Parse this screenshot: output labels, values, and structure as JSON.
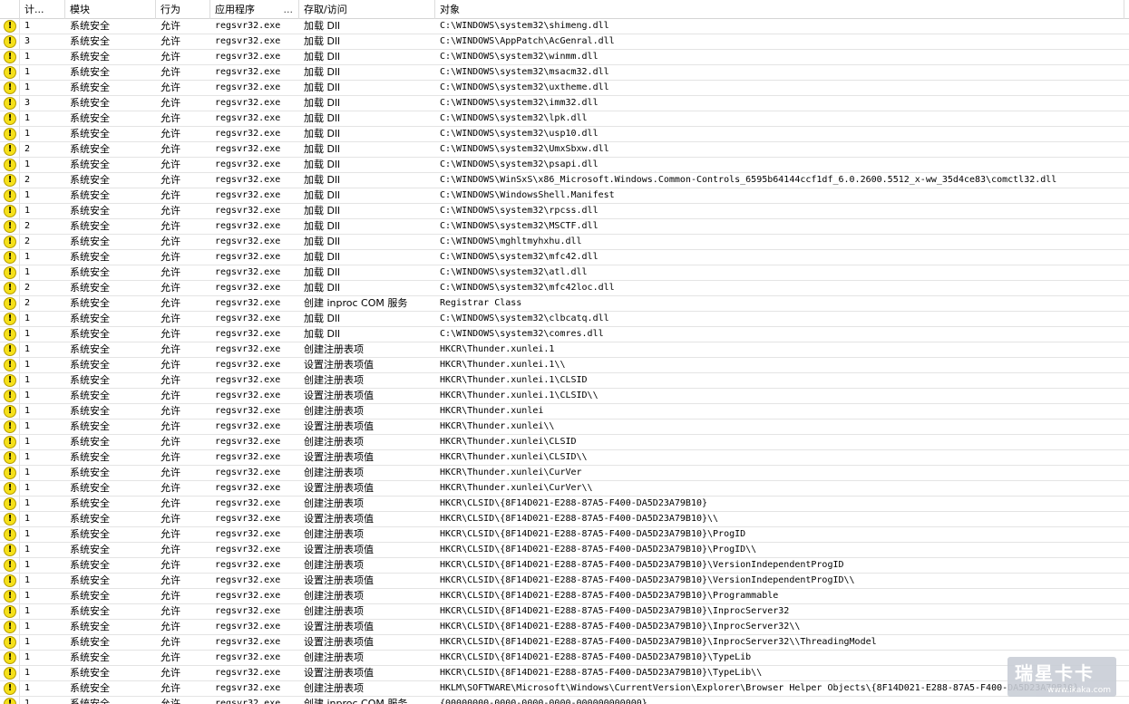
{
  "columns": {
    "count": "计...",
    "module": "模块",
    "action": "行为",
    "app": "应用程序",
    "app_more": "...",
    "access": "存取/访问",
    "object": "对象"
  },
  "colors": {
    "warning_icon": "#f6e11a"
  },
  "rows": [
    {
      "count": "1",
      "module": "系统安全",
      "action": "允许",
      "app": "regsvr32.exe",
      "access": "加载 Dll",
      "object": "C:\\WINDOWS\\system32\\shimeng.dll"
    },
    {
      "count": "3",
      "module": "系统安全",
      "action": "允许",
      "app": "regsvr32.exe",
      "access": "加载 Dll",
      "object": "C:\\WINDOWS\\AppPatch\\AcGenral.dll"
    },
    {
      "count": "1",
      "module": "系统安全",
      "action": "允许",
      "app": "regsvr32.exe",
      "access": "加载 Dll",
      "object": "C:\\WINDOWS\\system32\\winmm.dll"
    },
    {
      "count": "1",
      "module": "系统安全",
      "action": "允许",
      "app": "regsvr32.exe",
      "access": "加载 Dll",
      "object": "C:\\WINDOWS\\system32\\msacm32.dll"
    },
    {
      "count": "1",
      "module": "系统安全",
      "action": "允许",
      "app": "regsvr32.exe",
      "access": "加载 Dll",
      "object": "C:\\WINDOWS\\system32\\uxtheme.dll"
    },
    {
      "count": "3",
      "module": "系统安全",
      "action": "允许",
      "app": "regsvr32.exe",
      "access": "加载 Dll",
      "object": "C:\\WINDOWS\\system32\\imm32.dll"
    },
    {
      "count": "1",
      "module": "系统安全",
      "action": "允许",
      "app": "regsvr32.exe",
      "access": "加载 Dll",
      "object": "C:\\WINDOWS\\system32\\lpk.dll"
    },
    {
      "count": "1",
      "module": "系统安全",
      "action": "允许",
      "app": "regsvr32.exe",
      "access": "加载 Dll",
      "object": "C:\\WINDOWS\\system32\\usp10.dll"
    },
    {
      "count": "2",
      "module": "系统安全",
      "action": "允许",
      "app": "regsvr32.exe",
      "access": "加载 Dll",
      "object": "C:\\WINDOWS\\system32\\UmxSbxw.dll"
    },
    {
      "count": "1",
      "module": "系统安全",
      "action": "允许",
      "app": "regsvr32.exe",
      "access": "加载 Dll",
      "object": "C:\\WINDOWS\\system32\\psapi.dll"
    },
    {
      "count": "2",
      "module": "系统安全",
      "action": "允许",
      "app": "regsvr32.exe",
      "access": "加载 Dll",
      "object": "C:\\WINDOWS\\WinSxS\\x86_Microsoft.Windows.Common-Controls_6595b64144ccf1df_6.0.2600.5512_x-ww_35d4ce83\\comctl32.dll"
    },
    {
      "count": "1",
      "module": "系统安全",
      "action": "允许",
      "app": "regsvr32.exe",
      "access": "加载 Dll",
      "object": "C:\\WINDOWS\\WindowsShell.Manifest"
    },
    {
      "count": "1",
      "module": "系统安全",
      "action": "允许",
      "app": "regsvr32.exe",
      "access": "加载 Dll",
      "object": "C:\\WINDOWS\\system32\\rpcss.dll"
    },
    {
      "count": "2",
      "module": "系统安全",
      "action": "允许",
      "app": "regsvr32.exe",
      "access": "加载 Dll",
      "object": "C:\\WINDOWS\\system32\\MSCTF.dll"
    },
    {
      "count": "2",
      "module": "系统安全",
      "action": "允许",
      "app": "regsvr32.exe",
      "access": "加载 Dll",
      "object": "C:\\WINDOWS\\mghltmyhxhu.dll"
    },
    {
      "count": "1",
      "module": "系统安全",
      "action": "允许",
      "app": "regsvr32.exe",
      "access": "加载 Dll",
      "object": "C:\\WINDOWS\\system32\\mfc42.dll"
    },
    {
      "count": "1",
      "module": "系统安全",
      "action": "允许",
      "app": "regsvr32.exe",
      "access": "加载 Dll",
      "object": "C:\\WINDOWS\\system32\\atl.dll"
    },
    {
      "count": "2",
      "module": "系统安全",
      "action": "允许",
      "app": "regsvr32.exe",
      "access": "加载 Dll",
      "object": "C:\\WINDOWS\\system32\\mfc42loc.dll"
    },
    {
      "count": "2",
      "module": "系统安全",
      "action": "允许",
      "app": "regsvr32.exe",
      "access": "创建 inproc COM 服务",
      "object": "Registrar Class"
    },
    {
      "count": "1",
      "module": "系统安全",
      "action": "允许",
      "app": "regsvr32.exe",
      "access": "加载 Dll",
      "object": "C:\\WINDOWS\\system32\\clbcatq.dll"
    },
    {
      "count": "1",
      "module": "系统安全",
      "action": "允许",
      "app": "regsvr32.exe",
      "access": "加载 Dll",
      "object": "C:\\WINDOWS\\system32\\comres.dll"
    },
    {
      "count": "1",
      "module": "系统安全",
      "action": "允许",
      "app": "regsvr32.exe",
      "access": "创建注册表项",
      "object": "HKCR\\Thunder.xunlei.1"
    },
    {
      "count": "1",
      "module": "系统安全",
      "action": "允许",
      "app": "regsvr32.exe",
      "access": "设置注册表项值",
      "object": "HKCR\\Thunder.xunlei.1\\\\"
    },
    {
      "count": "1",
      "module": "系统安全",
      "action": "允许",
      "app": "regsvr32.exe",
      "access": "创建注册表项",
      "object": "HKCR\\Thunder.xunlei.1\\CLSID"
    },
    {
      "count": "1",
      "module": "系统安全",
      "action": "允许",
      "app": "regsvr32.exe",
      "access": "设置注册表项值",
      "object": "HKCR\\Thunder.xunlei.1\\CLSID\\\\"
    },
    {
      "count": "1",
      "module": "系统安全",
      "action": "允许",
      "app": "regsvr32.exe",
      "access": "创建注册表项",
      "object": "HKCR\\Thunder.xunlei"
    },
    {
      "count": "1",
      "module": "系统安全",
      "action": "允许",
      "app": "regsvr32.exe",
      "access": "设置注册表项值",
      "object": "HKCR\\Thunder.xunlei\\\\"
    },
    {
      "count": "1",
      "module": "系统安全",
      "action": "允许",
      "app": "regsvr32.exe",
      "access": "创建注册表项",
      "object": "HKCR\\Thunder.xunlei\\CLSID"
    },
    {
      "count": "1",
      "module": "系统安全",
      "action": "允许",
      "app": "regsvr32.exe",
      "access": "设置注册表项值",
      "object": "HKCR\\Thunder.xunlei\\CLSID\\\\"
    },
    {
      "count": "1",
      "module": "系统安全",
      "action": "允许",
      "app": "regsvr32.exe",
      "access": "创建注册表项",
      "object": "HKCR\\Thunder.xunlei\\CurVer"
    },
    {
      "count": "1",
      "module": "系统安全",
      "action": "允许",
      "app": "regsvr32.exe",
      "access": "设置注册表项值",
      "object": "HKCR\\Thunder.xunlei\\CurVer\\\\"
    },
    {
      "count": "1",
      "module": "系统安全",
      "action": "允许",
      "app": "regsvr32.exe",
      "access": "创建注册表项",
      "object": "HKCR\\CLSID\\{8F14D021-E288-87A5-F400-DA5D23A79B10}"
    },
    {
      "count": "1",
      "module": "系统安全",
      "action": "允许",
      "app": "regsvr32.exe",
      "access": "设置注册表项值",
      "object": "HKCR\\CLSID\\{8F14D021-E288-87A5-F400-DA5D23A79B10}\\\\"
    },
    {
      "count": "1",
      "module": "系统安全",
      "action": "允许",
      "app": "regsvr32.exe",
      "access": "创建注册表项",
      "object": "HKCR\\CLSID\\{8F14D021-E288-87A5-F400-DA5D23A79B10}\\ProgID"
    },
    {
      "count": "1",
      "module": "系统安全",
      "action": "允许",
      "app": "regsvr32.exe",
      "access": "设置注册表项值",
      "object": "HKCR\\CLSID\\{8F14D021-E288-87A5-F400-DA5D23A79B10}\\ProgID\\\\"
    },
    {
      "count": "1",
      "module": "系统安全",
      "action": "允许",
      "app": "regsvr32.exe",
      "access": "创建注册表项",
      "object": "HKCR\\CLSID\\{8F14D021-E288-87A5-F400-DA5D23A79B10}\\VersionIndependentProgID"
    },
    {
      "count": "1",
      "module": "系统安全",
      "action": "允许",
      "app": "regsvr32.exe",
      "access": "设置注册表项值",
      "object": "HKCR\\CLSID\\{8F14D021-E288-87A5-F400-DA5D23A79B10}\\VersionIndependentProgID\\\\"
    },
    {
      "count": "1",
      "module": "系统安全",
      "action": "允许",
      "app": "regsvr32.exe",
      "access": "创建注册表项",
      "object": "HKCR\\CLSID\\{8F14D021-E288-87A5-F400-DA5D23A79B10}\\Programmable"
    },
    {
      "count": "1",
      "module": "系统安全",
      "action": "允许",
      "app": "regsvr32.exe",
      "access": "创建注册表项",
      "object": "HKCR\\CLSID\\{8F14D021-E288-87A5-F400-DA5D23A79B10}\\InprocServer32"
    },
    {
      "count": "1",
      "module": "系统安全",
      "action": "允许",
      "app": "regsvr32.exe",
      "access": "设置注册表项值",
      "object": "HKCR\\CLSID\\{8F14D021-E288-87A5-F400-DA5D23A79B10}\\InprocServer32\\\\"
    },
    {
      "count": "1",
      "module": "系统安全",
      "action": "允许",
      "app": "regsvr32.exe",
      "access": "设置注册表项值",
      "object": "HKCR\\CLSID\\{8F14D021-E288-87A5-F400-DA5D23A79B10}\\InprocServer32\\\\ThreadingModel"
    },
    {
      "count": "1",
      "module": "系统安全",
      "action": "允许",
      "app": "regsvr32.exe",
      "access": "创建注册表项",
      "object": "HKCR\\CLSID\\{8F14D021-E288-87A5-F400-DA5D23A79B10}\\TypeLib"
    },
    {
      "count": "1",
      "module": "系统安全",
      "action": "允许",
      "app": "regsvr32.exe",
      "access": "设置注册表项值",
      "object": "HKCR\\CLSID\\{8F14D021-E288-87A5-F400-DA5D23A79B10}\\TypeLib\\\\"
    },
    {
      "count": "1",
      "module": "系统安全",
      "action": "允许",
      "app": "regsvr32.exe",
      "access": "创建注册表项",
      "object": "HKLM\\SOFTWARE\\Microsoft\\Windows\\CurrentVersion\\Explorer\\Browser Helper Objects\\{8F14D021-E288-87A5-F400-DA5D23A79B10}"
    },
    {
      "count": "1",
      "module": "系统安全",
      "action": "允许",
      "app": "regsvr32.exe",
      "access": "创建 inproc COM 服务",
      "object": "{00000000-0000-0000-0000-000000000000}"
    }
  ],
  "watermark": {
    "title": "瑞星卡卡",
    "url": "www.ikaka.com"
  }
}
